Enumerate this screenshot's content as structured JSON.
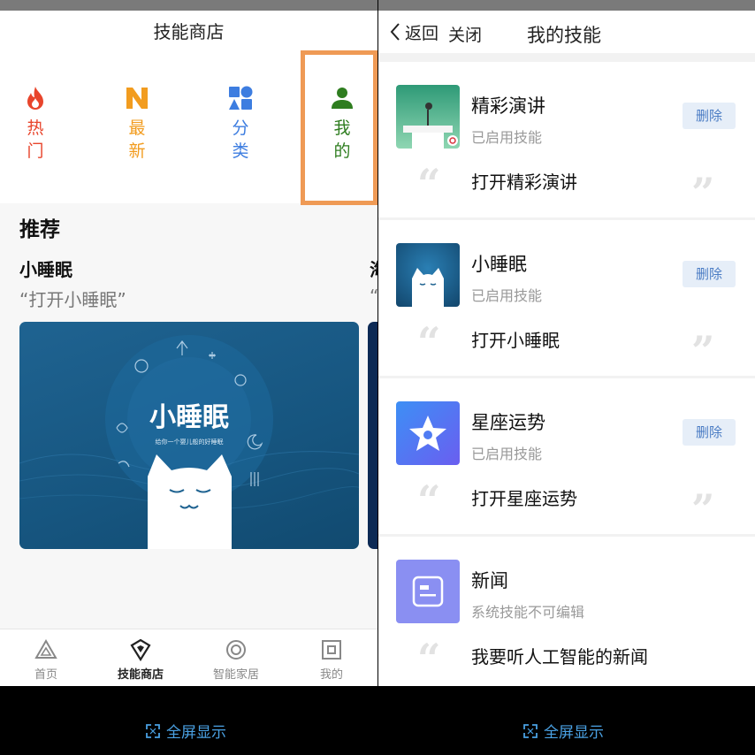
{
  "store": {
    "title": "技能商店",
    "categories": [
      {
        "label": "热门",
        "icon": "flame-icon",
        "color": "#e8452c"
      },
      {
        "label": "最新",
        "icon": "n-letter-icon",
        "color": "#f29c1f"
      },
      {
        "label": "分类",
        "icon": "category-grid-icon",
        "color": "#3d7de0"
      },
      {
        "label": "我的",
        "icon": "person-icon",
        "color": "#2e7d1f"
      }
    ],
    "recommend_title": "推荐",
    "featured": {
      "name": "小睡眠",
      "command": "“打开小睡眠”",
      "banner_title": "小睡眠",
      "banner_subtitle": "给你一个婴儿般的好睡眠"
    },
    "next_card": {
      "name": "海",
      "command": "“"
    },
    "tabs": [
      {
        "label": "首页",
        "icon": "home-triangle-icon"
      },
      {
        "label": "技能商店",
        "icon": "skill-store-icon"
      },
      {
        "label": "智能家居",
        "icon": "smart-home-icon"
      },
      {
        "label": "我的",
        "icon": "profile-square-icon"
      }
    ]
  },
  "my_skills": {
    "back_label": "返回",
    "close_label": "关闭",
    "title": "我的技能",
    "skills": [
      {
        "name": "精彩演讲",
        "status": "已启用技能",
        "delete_label": "删除",
        "command": "打开精彩演讲",
        "icon": "podium-icon"
      },
      {
        "name": "小睡眠",
        "status": "已启用技能",
        "delete_label": "删除",
        "command": "打开小睡眠",
        "icon": "sleeping-cat-icon"
      },
      {
        "name": "星座运势",
        "status": "已启用技能",
        "delete_label": "删除",
        "command": "打开星座运势",
        "icon": "star-icon"
      },
      {
        "name": "新闻",
        "status": "系统技能不可编辑",
        "command": "我要听人工智能的新闻",
        "icon": "news-icon"
      }
    ]
  },
  "fullscreen_label": "全屏显示",
  "colors": {
    "highlight_frame": "#ef9a55",
    "delete_text": "#4a7cc4",
    "fullscreen_text": "#4aa1e3"
  }
}
